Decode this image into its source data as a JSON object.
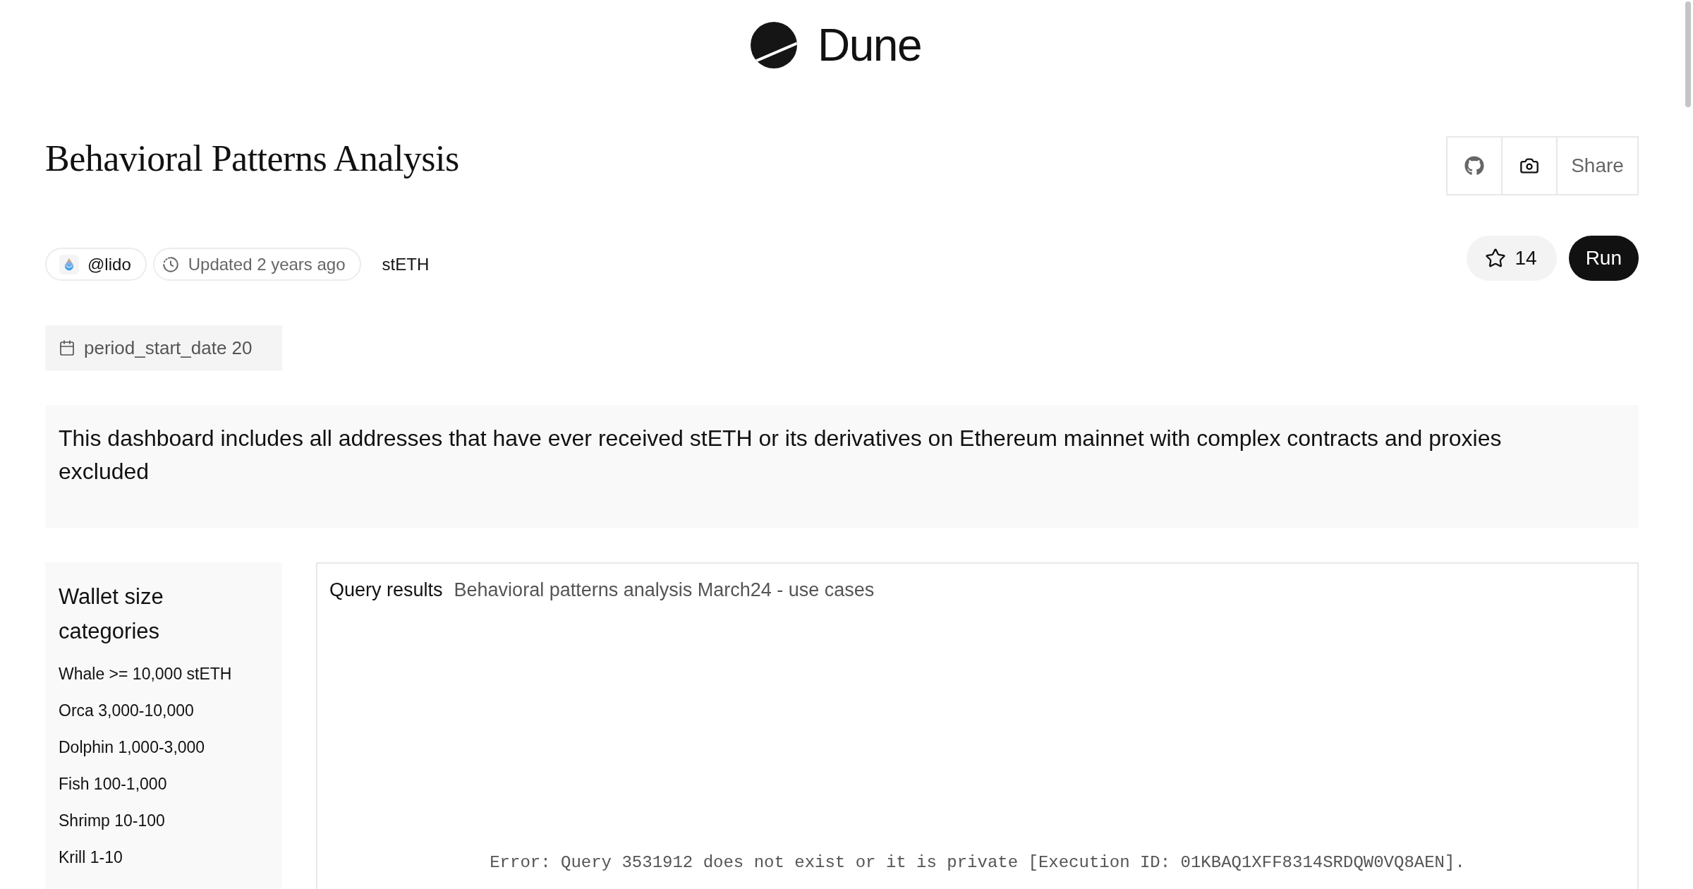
{
  "header": {
    "logo_text": "Dune"
  },
  "title": "Behavioral Patterns Analysis",
  "share_button": {
    "label": "Share"
  },
  "meta": {
    "author": "@lido",
    "updated": "Updated 2 years ago",
    "tag": "stETH"
  },
  "star_button": {
    "count": "14"
  },
  "run_button": {
    "label": "Run"
  },
  "parameters": [
    {
      "kind": "date",
      "name": "period_start_date",
      "value": "20"
    }
  ],
  "description": "This dashboard includes all addresses that have ever received stETH or its derivatives on Ethereum mainnet with complex contracts and proxies excluded",
  "sidebar": {
    "title": "Wallet size categories",
    "items": [
      "Whale >= 10,000 stETH",
      "Orca 3,000-10,000",
      "Dolphin 1,000-3,000",
      "Fish 100-1,000",
      "Shrimp 10-100",
      "Krill 1-10"
    ]
  },
  "query_panel": {
    "label": "Query results",
    "query_name": "Behavioral patterns analysis March24 - use cases",
    "error": "Error: Query 3531912 does not exist or it is private [Execution ID: 01KBAQ1XFF8314SRDQW0VQ8AEN]."
  }
}
